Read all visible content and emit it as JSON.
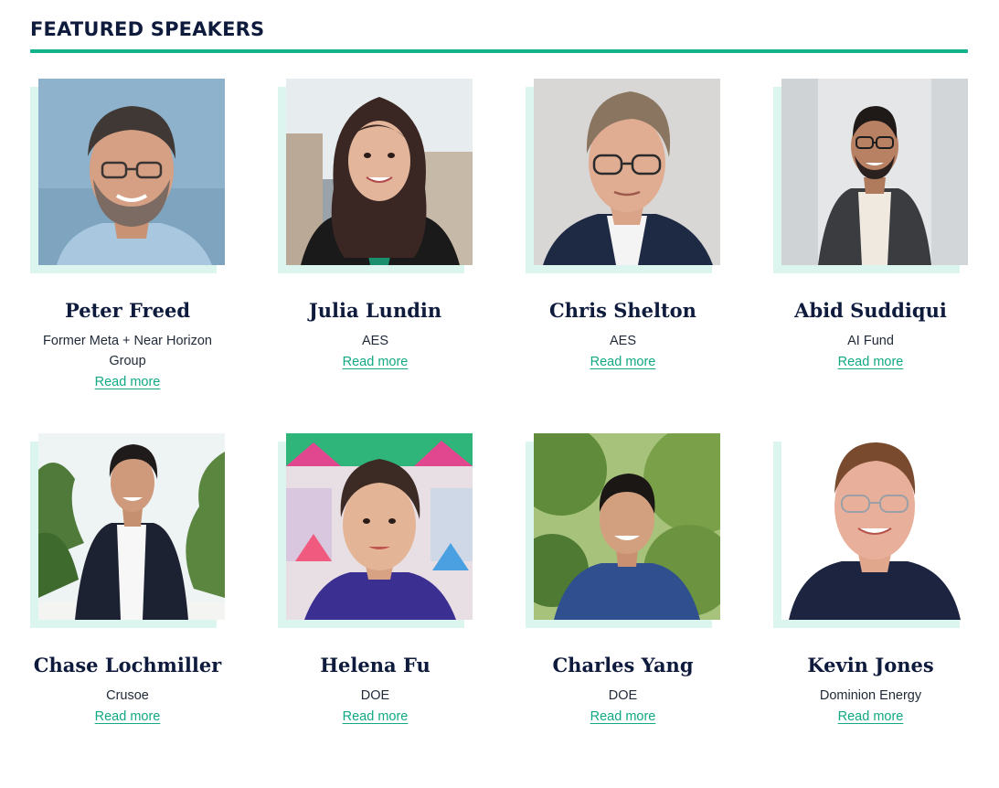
{
  "section": {
    "title": "FEATURED SPEAKERS",
    "accent_color": "#12b28c",
    "title_color": "#0f1b3d",
    "photo_accent_color": "#dcf5ee"
  },
  "speakers": [
    {
      "name": "Peter Freed",
      "org": "Former Meta + Near Horizon Group",
      "link": "Read more",
      "photo": "headshot-man-glasses-beard-sky"
    },
    {
      "name": "Julia Lundin",
      "org": "AES",
      "link": "Read more",
      "photo": "headshot-woman-dark-hair-city"
    },
    {
      "name": "Chris Shelton",
      "org": "AES",
      "link": "Read more",
      "photo": "headshot-man-glasses-suit-grey"
    },
    {
      "name": "Abid Suddiqui",
      "org": "AI Fund",
      "link": "Read more",
      "photo": "headshot-man-glasses-blazer-office"
    },
    {
      "name": "Chase Lochmiller",
      "org": "Crusoe",
      "link": "Read more",
      "photo": "headshot-man-suit-palms"
    },
    {
      "name": "Helena Fu",
      "org": "DOE",
      "link": "Read more",
      "photo": "headshot-woman-colorful-backdrop"
    },
    {
      "name": "Charles Yang",
      "org": "DOE",
      "link": "Read more",
      "photo": "headshot-man-blue-shirt-trees"
    },
    {
      "name": "Kevin Jones",
      "org": "Dominion Energy",
      "link": "Read more",
      "photo": "headshot-man-glasses-navy-white"
    }
  ]
}
